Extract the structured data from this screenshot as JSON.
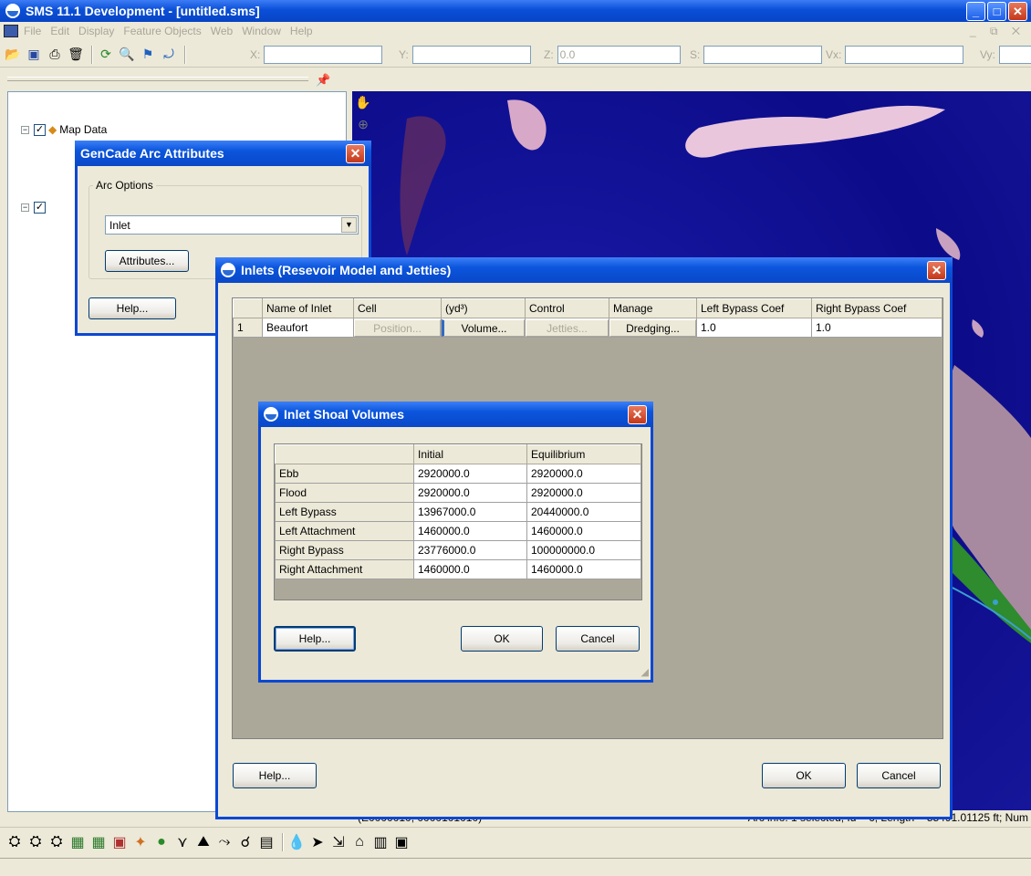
{
  "app": {
    "title": "SMS 11.1 Development - [untitled.sms]",
    "window_controls": [
      "minimize",
      "maximize",
      "close"
    ]
  },
  "menu": {
    "items": [
      "File",
      "Edit",
      "Display",
      "Feature Objects",
      "Web",
      "Window",
      "Help"
    ]
  },
  "coords": {
    "x_label": "X:",
    "x_value": "",
    "y_label": "Y:",
    "y_value": "",
    "z_label": "Z:",
    "z_value": "0.0",
    "s_label": "S:",
    "s_value": "",
    "vx_label": "Vx:",
    "vx_value": "",
    "vy_label": "Vy:",
    "vy_value": ""
  },
  "tree": {
    "root_label": "Map Data"
  },
  "status": {
    "left": "(E0000010, 0000101010)",
    "right": "Arc info: 1 selected, Id = 6, Length = 55491.01125 ft; Num"
  },
  "arc_dialog": {
    "title": "GenCade Arc Attributes",
    "group_label": "Arc Options",
    "selected_option": "Inlet",
    "attributes_button": "Attributes...",
    "help_button": "Help..."
  },
  "inlets_dialog": {
    "title": "Inlets (Resevoir Model and Jetties)",
    "columns": [
      "",
      "Name of Inlet",
      "Cell",
      "(yd³)",
      "Control",
      "Manage",
      "Left Bypass Coef",
      "Right Bypass Coef"
    ],
    "rows": [
      {
        "index": "1",
        "name": "Beaufort",
        "cell_button": "Position...",
        "volume_button": "Volume...",
        "control_button": "Jetties...",
        "manage_button": "Dredging...",
        "left_bypass": "1.0",
        "right_bypass": "1.0"
      }
    ],
    "help_button": "Help...",
    "ok_button": "OK",
    "cancel_button": "Cancel"
  },
  "shoal_dialog": {
    "title": "Inlet Shoal Volumes",
    "columns": [
      "",
      "Initial",
      "Equilibrium"
    ],
    "rows": [
      {
        "label": "Ebb",
        "initial": "2920000.0",
        "equilibrium": "2920000.0"
      },
      {
        "label": "Flood",
        "initial": "2920000.0",
        "equilibrium": "2920000.0"
      },
      {
        "label": "Left Bypass",
        "initial": "13967000.0",
        "equilibrium": "20440000.0"
      },
      {
        "label": "Left Attachment",
        "initial": "1460000.0",
        "equilibrium": "1460000.0"
      },
      {
        "label": "Right Bypass",
        "initial": "23776000.0",
        "equilibrium": "100000000.0"
      },
      {
        "label": "Right Attachment",
        "initial": "1460000.0",
        "equilibrium": "1460000.0"
      }
    ],
    "help_button": "Help...",
    "ok_button": "OK",
    "cancel_button": "Cancel"
  }
}
